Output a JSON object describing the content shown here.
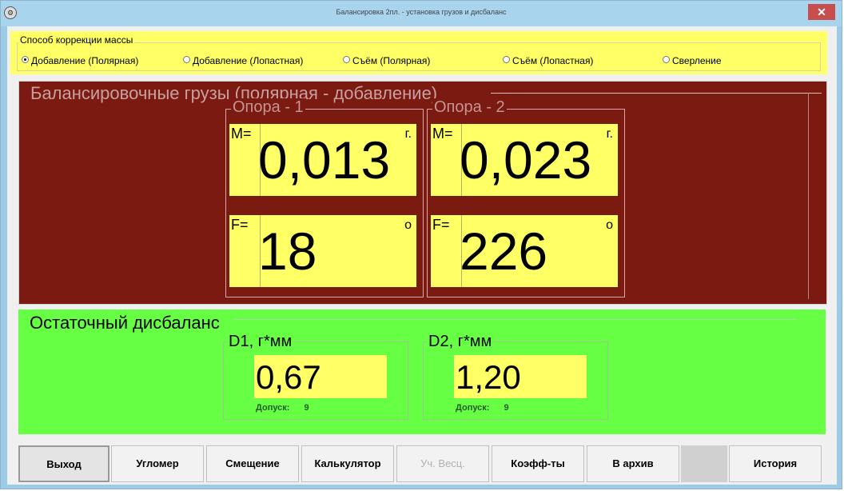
{
  "window": {
    "title": "Балансировка 2пл. - установка грузов и дисбаланс",
    "close": "✕"
  },
  "mass_correction": {
    "title": "Способ коррекции массы",
    "options": [
      {
        "label": "Добавление (Полярная)",
        "checked": true
      },
      {
        "label": "Добавление (Лопастная)",
        "checked": false
      },
      {
        "label": "Съём (Полярная)",
        "checked": false
      },
      {
        "label": "Съём (Лопастная)",
        "checked": false
      },
      {
        "label": "Сверление",
        "checked": false
      }
    ]
  },
  "weights": {
    "title": "Балансировочные грузы (полярная - добавление)",
    "supports": [
      {
        "title": "Опора - 1",
        "mass_label": "M=",
        "mass_value": "0,013",
        "mass_unit": "г.",
        "angle_label": "F=",
        "angle_value": "18",
        "angle_unit": "о"
      },
      {
        "title": "Опора - 2",
        "mass_label": "M=",
        "mass_value": "0,023",
        "mass_unit": "г.",
        "angle_label": "F=",
        "angle_value": "226",
        "angle_unit": "о"
      }
    ]
  },
  "residual": {
    "title": "Остаточный дисбаланс",
    "items": [
      {
        "label": "D1, г*мм",
        "value": "0,67",
        "tolerance_label": "Допуск:",
        "tolerance_value": "9"
      },
      {
        "label": "D2, г*мм",
        "value": "1,20",
        "tolerance_label": "Допуск:",
        "tolerance_value": "9"
      }
    ]
  },
  "buttons": {
    "exit": "Выход",
    "angle": "Угломер",
    "offset": "Смещение",
    "calculator": "Калькулятор",
    "weights": "Уч. Весц.",
    "coefficients": "Коэфф-ты",
    "archive": "В архив",
    "history": "История"
  }
}
